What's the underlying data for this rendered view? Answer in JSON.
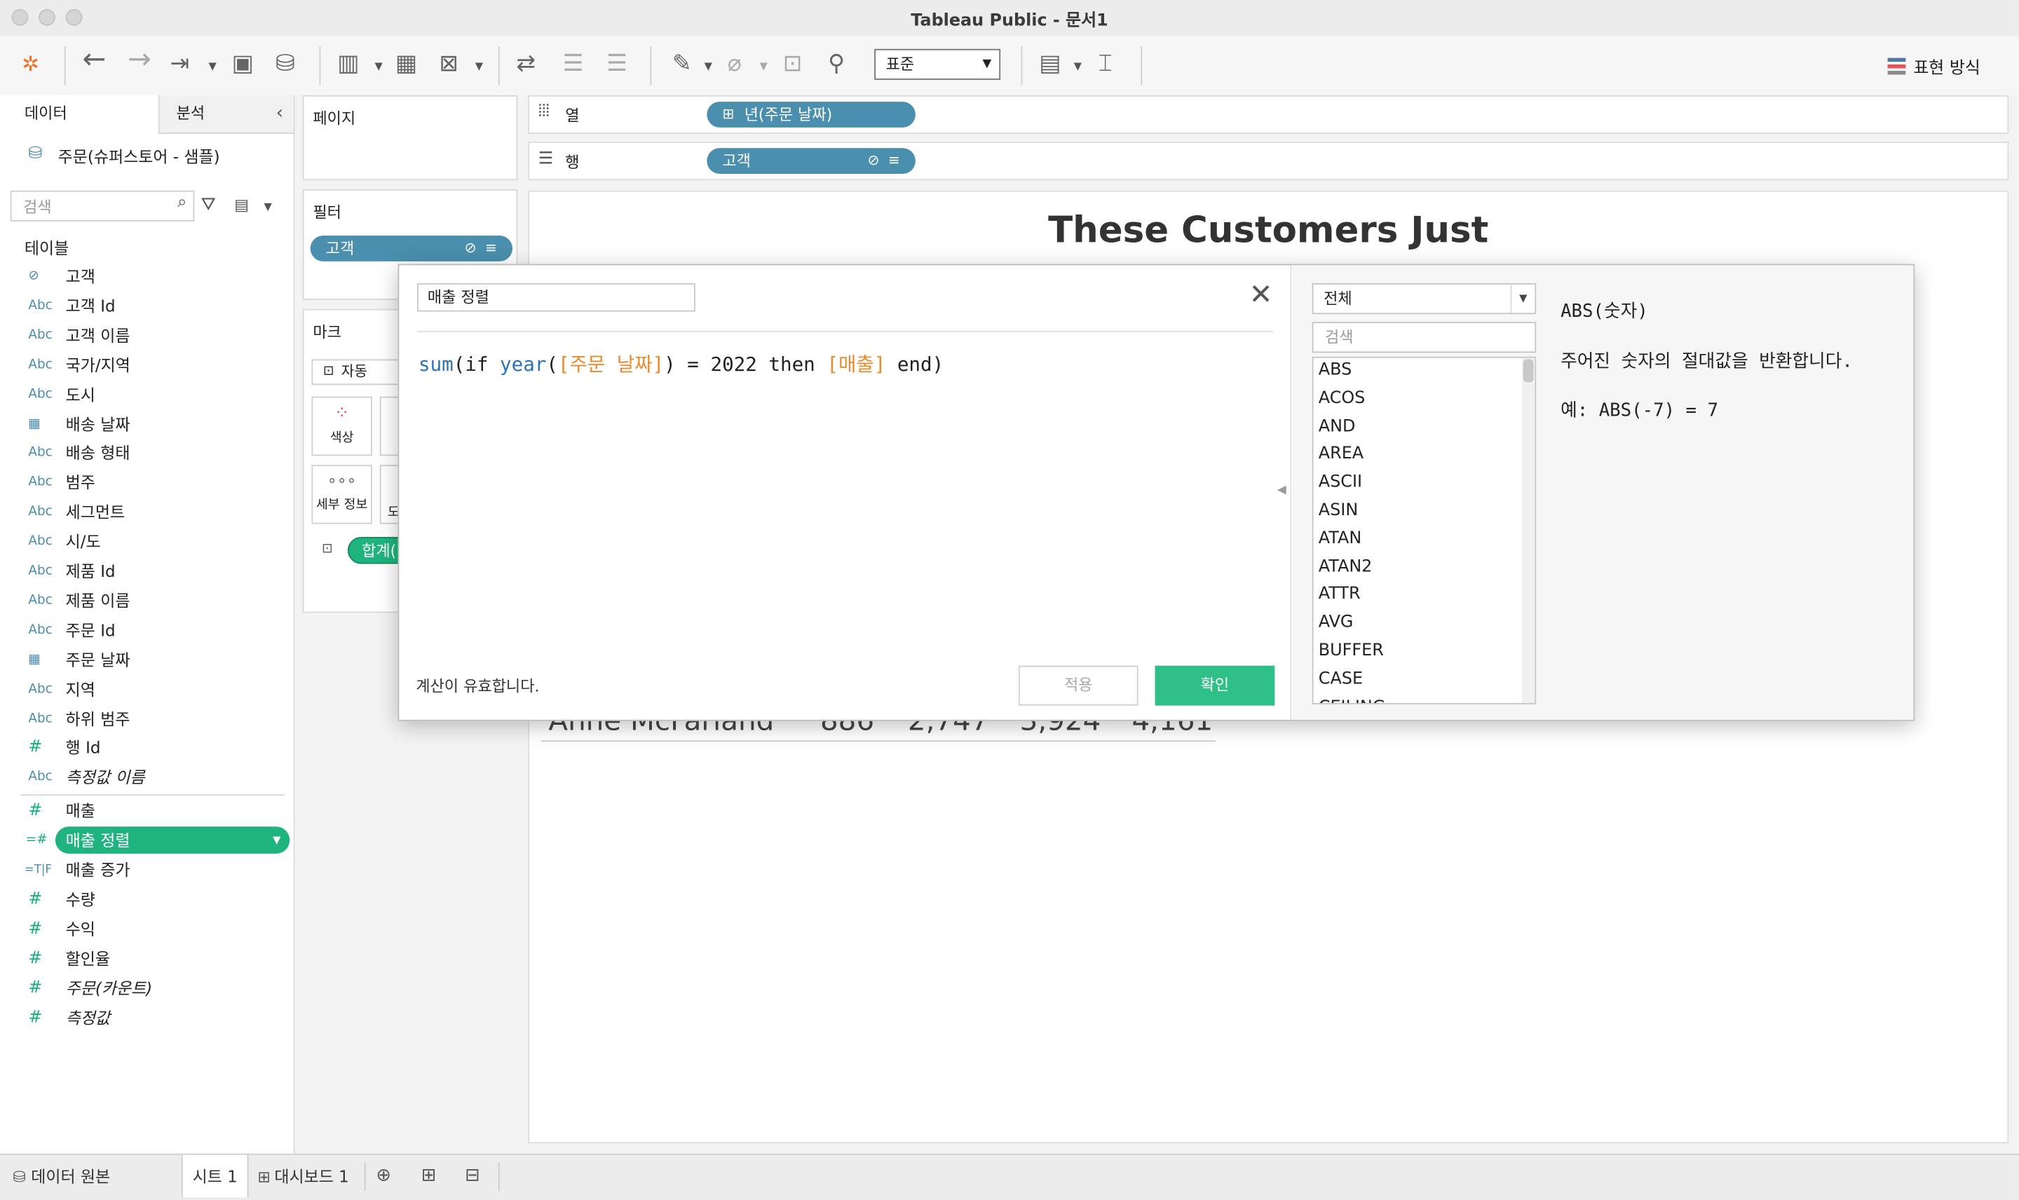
{
  "window": {
    "title": "Tableau Public - 문서1"
  },
  "toolbar": {
    "standard_select": "표준",
    "show_me": "표현 방식"
  },
  "left_panel": {
    "tabs": [
      "데이터",
      "분석"
    ],
    "datasource": "주문(슈퍼스토어 - 샘플)",
    "search_placeholder": "검색",
    "tables_header": "테이블",
    "fields": [
      {
        "type": "링크",
        "label": "고객"
      },
      {
        "type": "Abc",
        "label": "고객 Id"
      },
      {
        "type": "Abc",
        "label": "고객 이름"
      },
      {
        "type": "Abc",
        "label": "국가/지역"
      },
      {
        "type": "Abc",
        "label": "도시"
      },
      {
        "type": "date",
        "label": "배송 날짜"
      },
      {
        "type": "Abc",
        "label": "배송 형태"
      },
      {
        "type": "Abc",
        "label": "범주"
      },
      {
        "type": "Abc",
        "label": "세그먼트"
      },
      {
        "type": "Abc",
        "label": "시/도"
      },
      {
        "type": "Abc",
        "label": "제품 Id"
      },
      {
        "type": "Abc",
        "label": "제품 이름"
      },
      {
        "type": "Abc",
        "label": "주문 Id"
      },
      {
        "type": "date",
        "label": "주문 날짜"
      },
      {
        "type": "Abc",
        "label": "지역"
      },
      {
        "type": "Abc",
        "label": "하위 범주"
      },
      {
        "type": "#",
        "label": "행 Id"
      },
      {
        "type": "Abc",
        "label": "측정값 이름"
      }
    ],
    "measures": [
      {
        "type": "#",
        "label": "매출"
      },
      {
        "type": "=#",
        "label": "매출 정렬"
      },
      {
        "type": "=T|F",
        "label": "매출 증가"
      },
      {
        "type": "#",
        "label": "수량"
      },
      {
        "type": "#",
        "label": "수익"
      },
      {
        "type": "#",
        "label": "할인율"
      },
      {
        "type": "#",
        "label": "주문(카운트)"
      },
      {
        "type": "#",
        "label": "측정값"
      }
    ]
  },
  "shelves": {
    "pages": "페이지",
    "filters": "필터",
    "filter_pill": "고객",
    "marks": "마크",
    "marks_type": "자동",
    "color": "색상",
    "detail": "세부 정보",
    "tooltip_partial": "도",
    "sum_pill": "합계(",
    "columns_label": "열",
    "columns_pill": "년(주문 날짜)",
    "rows_label": "행",
    "rows_pill": "고객"
  },
  "view": {
    "title": "These Customers Just",
    "ghost_row": {
      "name": "Anne McFarland",
      "values": [
        "886",
        "2,747",
        "3,924",
        "4,161"
      ]
    }
  },
  "calc_dialog": {
    "name": "매출 정렬",
    "formula": {
      "fn_sum": "sum",
      "p1": "(if ",
      "fn_year": "year",
      "p2": "(",
      "field_date": "[주문 날짜]",
      "p3": ") = 2022 then ",
      "field_sales": "[매출]",
      "p4": " end)"
    },
    "valid_message": "계산이 유효합니다.",
    "apply_label": "적용",
    "ok_label": "확인",
    "category": "전체",
    "fn_search_placeholder": "검색",
    "functions": [
      "ABS",
      "ACOS",
      "AND",
      "AREA",
      "ASCII",
      "ASIN",
      "ATAN",
      "ATAN2",
      "ATTR",
      "AVG",
      "BUFFER",
      "CASE",
      "CEILING"
    ],
    "help_title": "ABS(숫자)",
    "help_desc": "주어진 숫자의 절대값을 반환합니다.",
    "help_example": "예: ABS(-7) = 7"
  },
  "status_bar": {
    "datasource": "데이터 원본",
    "sheet": "시트 1",
    "dashboard": "대시보드 1"
  },
  "colors": {
    "accent_green": "#1fb47d",
    "pill_blue": "#4a8fad",
    "ok_green": "#2fbf88",
    "field_orange": "#ea8a2a",
    "fn_blue": "#2a73b8"
  }
}
